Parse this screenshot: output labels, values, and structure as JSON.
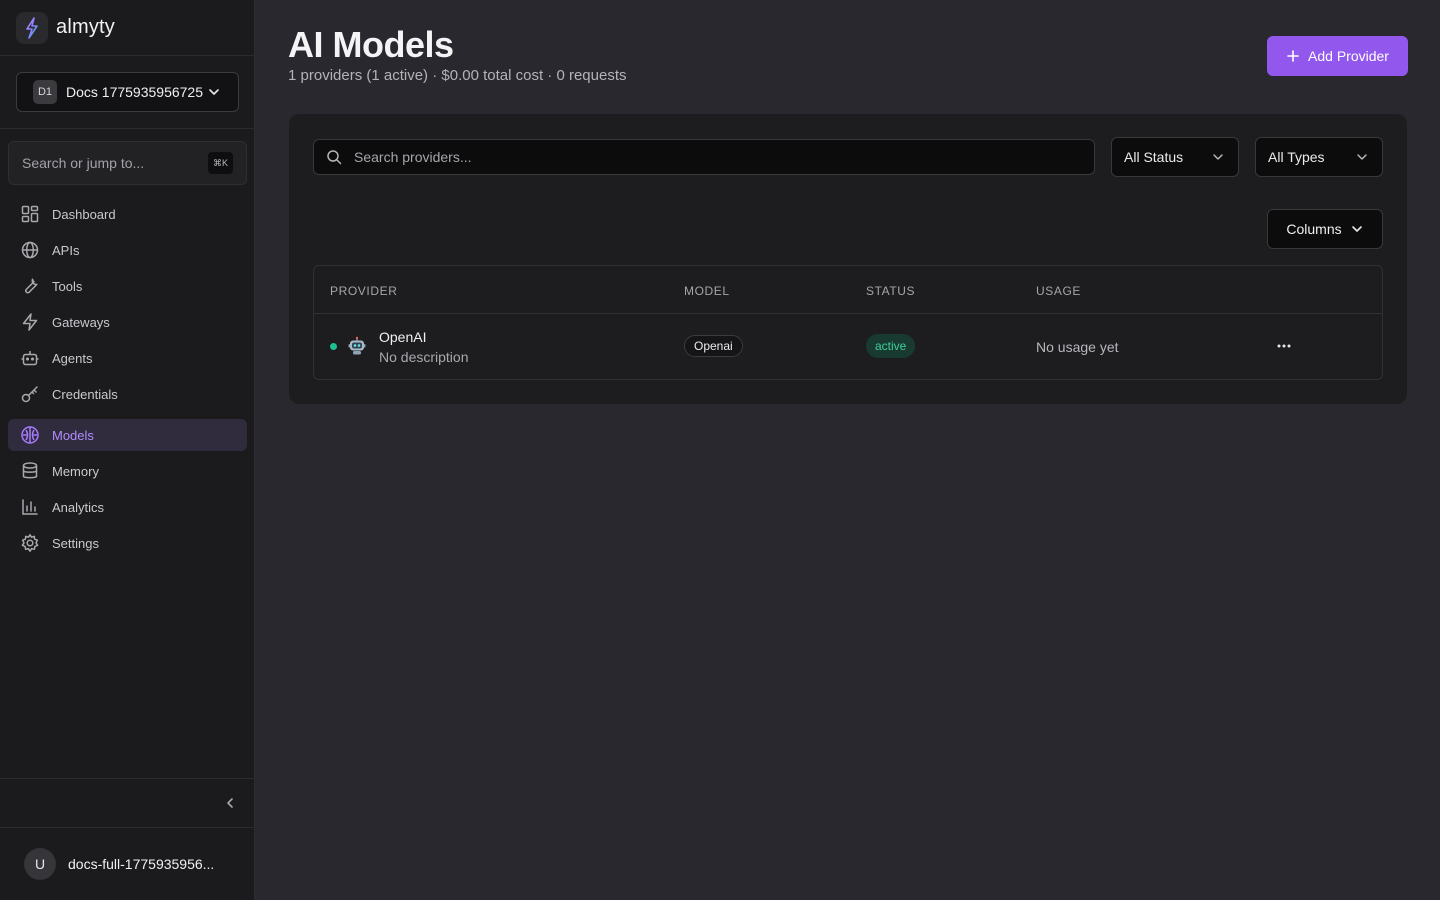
{
  "brand": {
    "name": "almyty",
    "logo_icon": "bolt-logo-icon"
  },
  "org": {
    "initials": "D1",
    "name": "Docs 1775935956725"
  },
  "side_search": {
    "placeholder": "Search or jump to...",
    "shortcut": "⌘K"
  },
  "nav": [
    {
      "label": "Dashboard",
      "icon": "dashboard-grid-icon",
      "active": false
    },
    {
      "label": "APIs",
      "icon": "globe-icon",
      "active": false
    },
    {
      "label": "Tools",
      "icon": "wrench-icon",
      "active": false
    },
    {
      "label": "Gateways",
      "icon": "zap-icon",
      "active": false
    },
    {
      "label": "Agents",
      "icon": "bot-icon",
      "active": false
    },
    {
      "label": "Credentials",
      "icon": "key-icon",
      "active": false
    },
    {
      "label": "Models",
      "icon": "brain-icon",
      "active": true
    },
    {
      "label": "Memory",
      "icon": "database-icon",
      "active": false
    },
    {
      "label": "Analytics",
      "icon": "bar-chart-icon",
      "active": false
    },
    {
      "label": "Settings",
      "icon": "gear-icon",
      "active": false
    }
  ],
  "user": {
    "initial": "U",
    "name": "docs-full-1775935956..."
  },
  "page": {
    "title": "AI Models",
    "subtitle": "1 providers (1 active) · $0.00 total cost · 0 requests",
    "add_button": "Add Provider"
  },
  "filters": {
    "search_placeholder": "Search providers...",
    "status": "All Status",
    "types": "All Types",
    "columns": "Columns"
  },
  "table": {
    "headers": [
      "PROVIDER",
      "MODEL",
      "STATUS",
      "USAGE"
    ],
    "rows": [
      {
        "provider": "OpenAI",
        "description": "No description",
        "model": "Openai",
        "status": "active",
        "usage": "No usage yet"
      }
    ]
  },
  "colors": {
    "accent": "#9257ec",
    "active_nav": "#b28bff",
    "status_active": "#3ecf9a",
    "background": "#29282e",
    "sidebar": "#1b1b1d"
  }
}
